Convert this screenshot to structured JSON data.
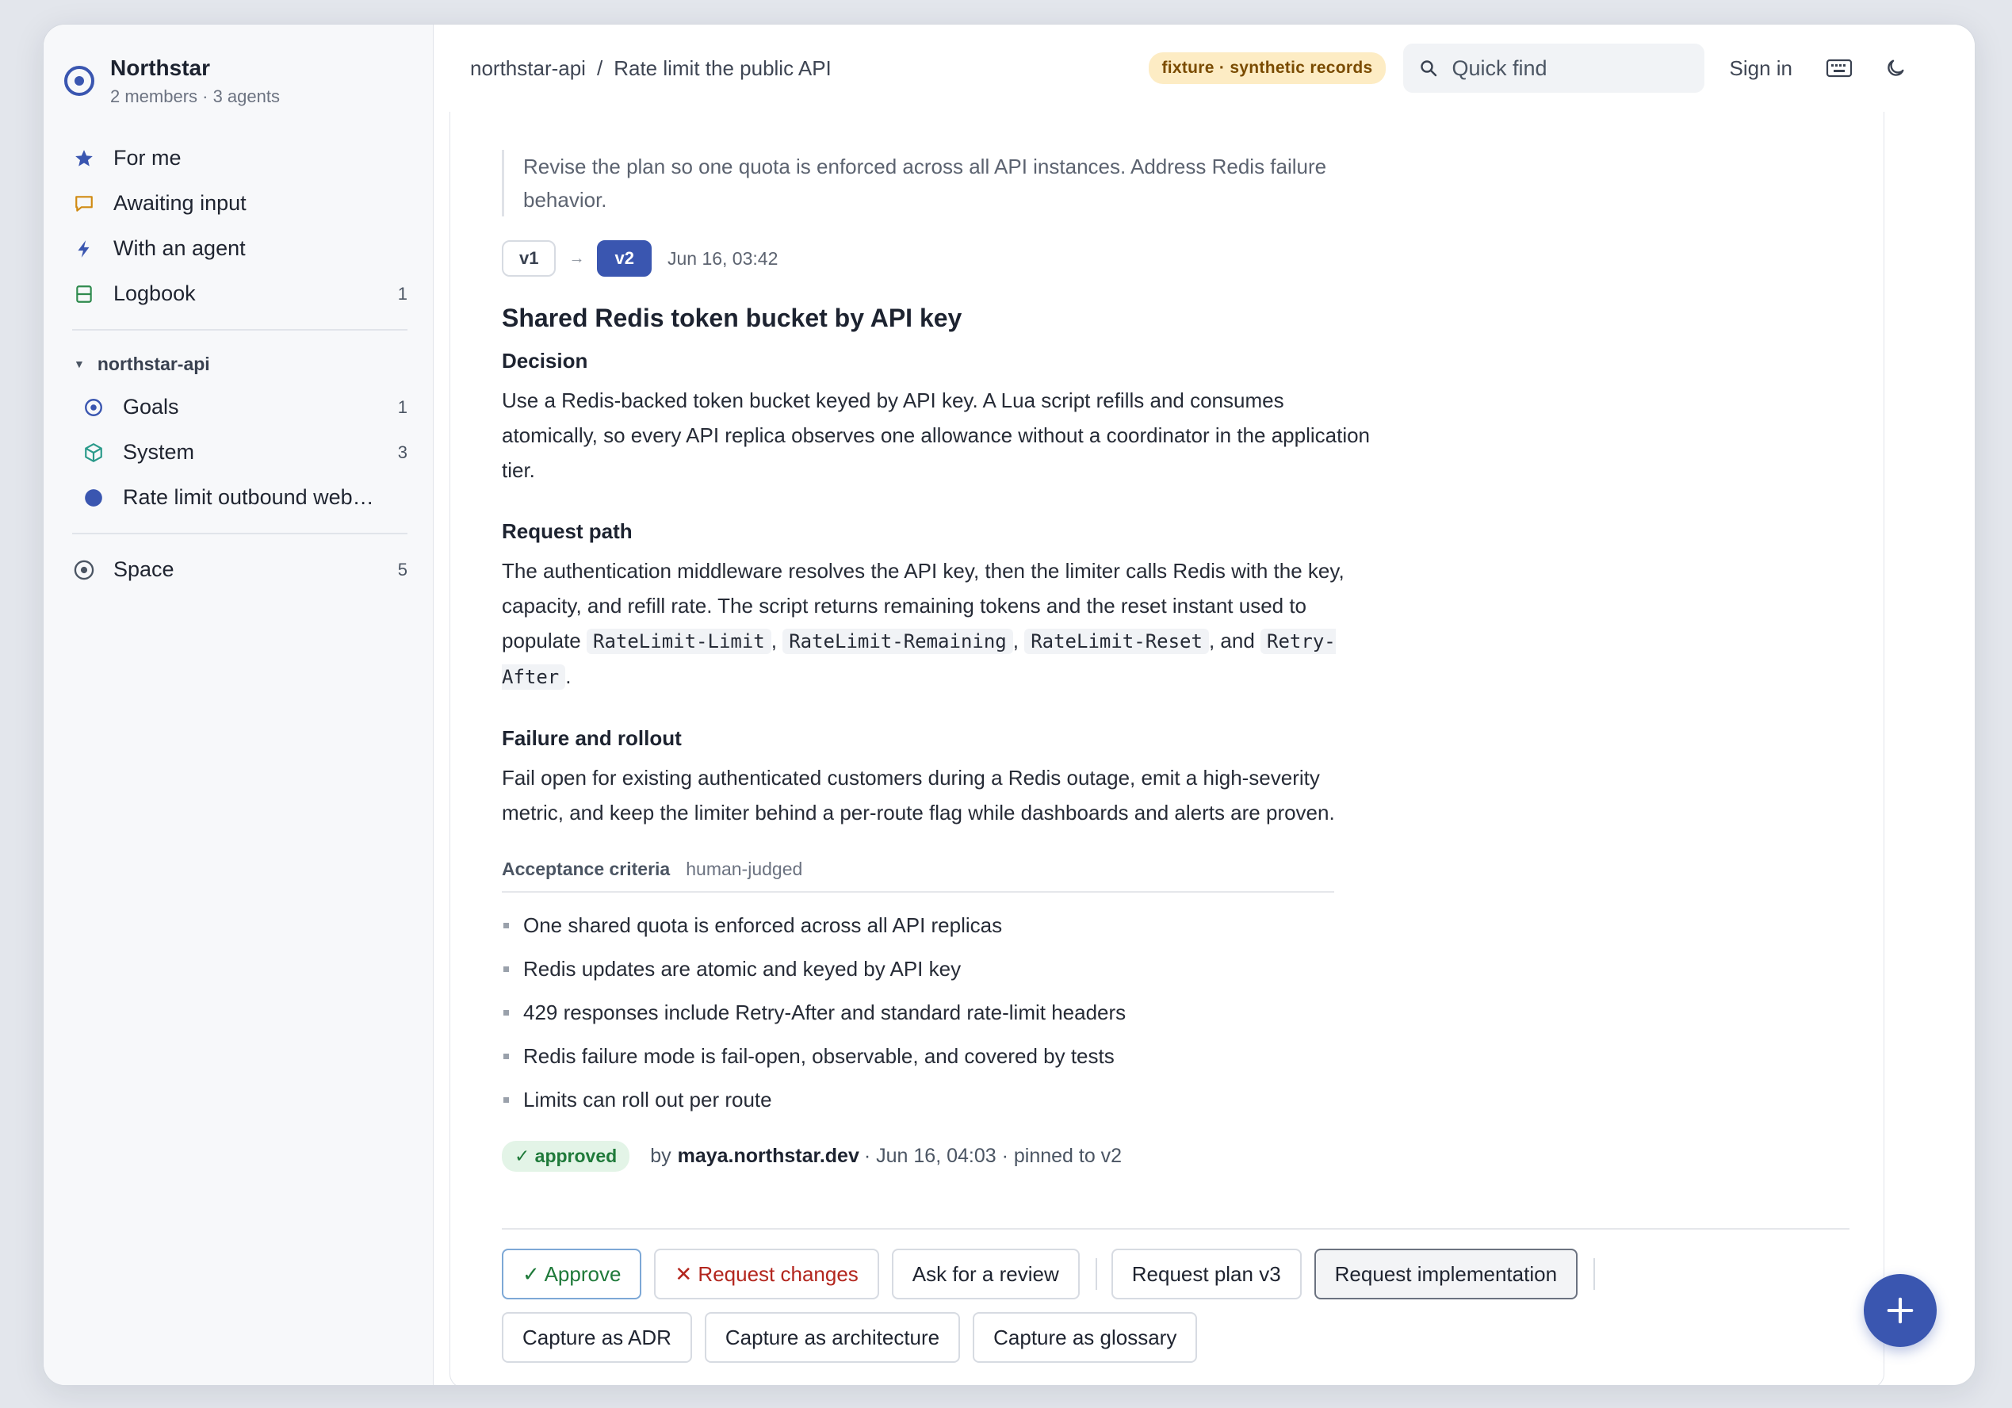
{
  "workspace": {
    "name": "Northstar",
    "subtitle": "2 members · 3 agents"
  },
  "sidebar": {
    "items": [
      {
        "label": "For me",
        "count": ""
      },
      {
        "label": "Awaiting input",
        "count": ""
      },
      {
        "label": "With an agent",
        "count": ""
      },
      {
        "label": "Logbook",
        "count": "1"
      }
    ],
    "group": {
      "label": "northstar-api",
      "items": [
        {
          "label": "Goals",
          "count": "1"
        },
        {
          "label": "System",
          "count": "3"
        },
        {
          "label": "Rate limit outbound webhooks",
          "count": ""
        }
      ]
    },
    "space": {
      "label": "Space",
      "count": "5"
    }
  },
  "topbar": {
    "crumb_project": "northstar-api",
    "crumb_sep": "/",
    "crumb_page": "Rate limit the public API",
    "fixture_badge": "fixture · synthetic records",
    "search_placeholder": "Quick find",
    "sign_in": "Sign in"
  },
  "doc": {
    "feedback_quote": "Revise the plan so one quota is enforced across all API instances. Address Redis failure behavior.",
    "versions": {
      "prev": "v1",
      "current": "v2",
      "date": "Jun 16, 03:42"
    },
    "title": "Shared Redis token bucket by API key",
    "decision_heading": "Decision",
    "decision_body": "Use a Redis-backed token bucket keyed by API key. A Lua script refills and consumes atomically, so every API replica observes one allowance without a coordinator in the application tier.",
    "request_heading": "Request path",
    "request_body_1": "The authentication middleware resolves the API key, then the limiter calls Redis with the key, capacity, and refill rate. The script returns remaining tokens and the reset instant used to populate",
    "request_code_1": "RateLimit-Limit",
    "request_code_2": "RateLimit-Remaining",
    "request_code_3": "RateLimit-Reset",
    "request_and": ", and",
    "request_code_4": "Retry-After",
    "failure_heading": "Failure and rollout",
    "failure_body": "Fail open for existing authenticated customers during a Redis outage, emit a high-severity metric, and keep the limiter behind a per-route flag while dashboards and alerts are proven.",
    "acceptance": {
      "title": "Acceptance criteria",
      "subtitle": "human-judged",
      "items": [
        "One shared quota is enforced across all API replicas",
        "Redis updates are atomic and keyed by API key",
        "429 responses include Retry-After and standard rate-limit headers",
        "Redis failure mode is fail-open, observable, and covered by tests",
        "Limits can roll out per route"
      ]
    },
    "status": {
      "badge": "✓ approved",
      "by": "by",
      "user": "maya.northstar.dev",
      "meta": "· Jun 16, 04:03 · pinned to v2"
    }
  },
  "actions": {
    "approve": "✓ Approve",
    "request_changes": "✕ Request changes",
    "ask_review": "Ask for a review",
    "request_plan": "Request plan v3",
    "request_impl": "Request implementation",
    "capture_adr": "Capture as ADR",
    "capture_arch": "Capture as architecture",
    "capture_glossary": "Capture as glossary"
  },
  "colors": {
    "accent": "#3a56b0",
    "approved": "#1f7a3a",
    "danger": "#b3261e",
    "fixture_bg": "#fdecc4"
  }
}
